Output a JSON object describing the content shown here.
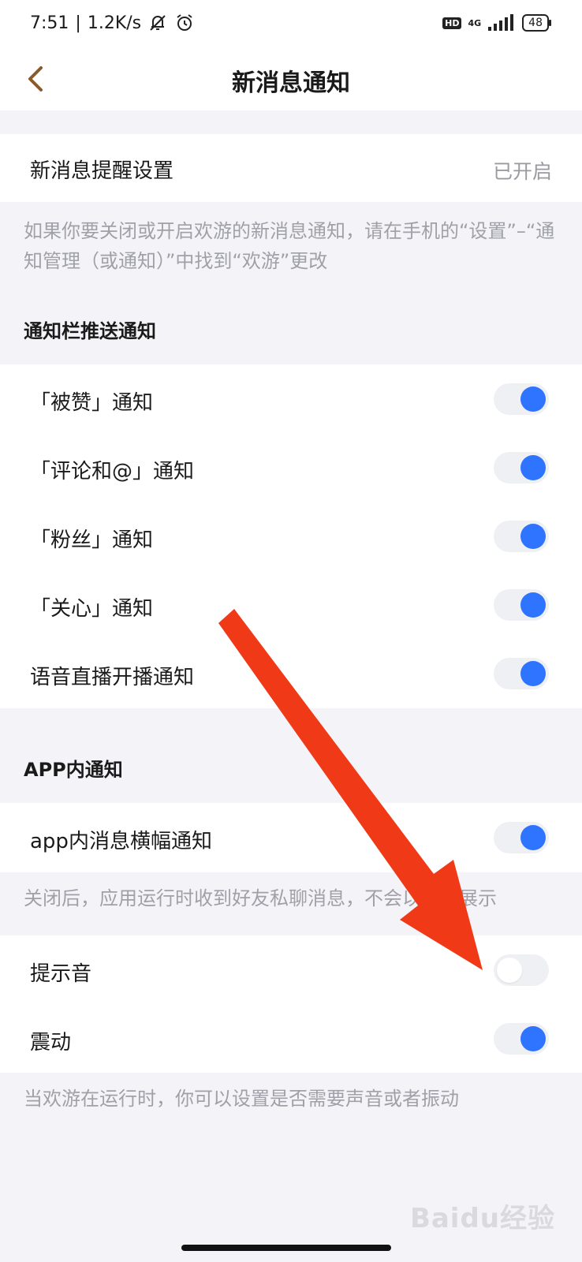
{
  "status_bar": {
    "time": "7:51",
    "net_speed": "1.2K/s",
    "network": "4G",
    "hd": "HD",
    "battery": "48"
  },
  "header": {
    "title": "新消息通知"
  },
  "reminder": {
    "label": "新消息提醒设置",
    "value": "已开启",
    "note": "如果你要关闭或开启欢游的新消息通知，请在手机的“设置”–“通知管理（或通知）”中找到“欢游”更改"
  },
  "push_section": {
    "title": "通知栏推送通知",
    "items": [
      {
        "label": "「被赞」通知",
        "enabled": true
      },
      {
        "label": "「评论和@」通知",
        "enabled": true
      },
      {
        "label": "「粉丝」通知",
        "enabled": true
      },
      {
        "label": "「关心」通知",
        "enabled": true
      },
      {
        "label": "语音直播开播通知",
        "enabled": true
      }
    ]
  },
  "app_section": {
    "title": "APP内通知",
    "banner": {
      "label": "app内消息横幅通知",
      "enabled": true
    },
    "banner_note": "关闭后，应用运行时收到好友私聊消息，不会以横幅展示",
    "sound": {
      "label": "提示音",
      "enabled": false
    },
    "vibrate": {
      "label": "震动",
      "enabled": true
    },
    "bottom_note": "当欢游在运行时，你可以设置是否需要声音或者振动"
  },
  "watermark": "Baidu经验",
  "colors": {
    "accent": "#2f74ff",
    "arrow": "#f03a17",
    "back": "#8a5a2b"
  }
}
